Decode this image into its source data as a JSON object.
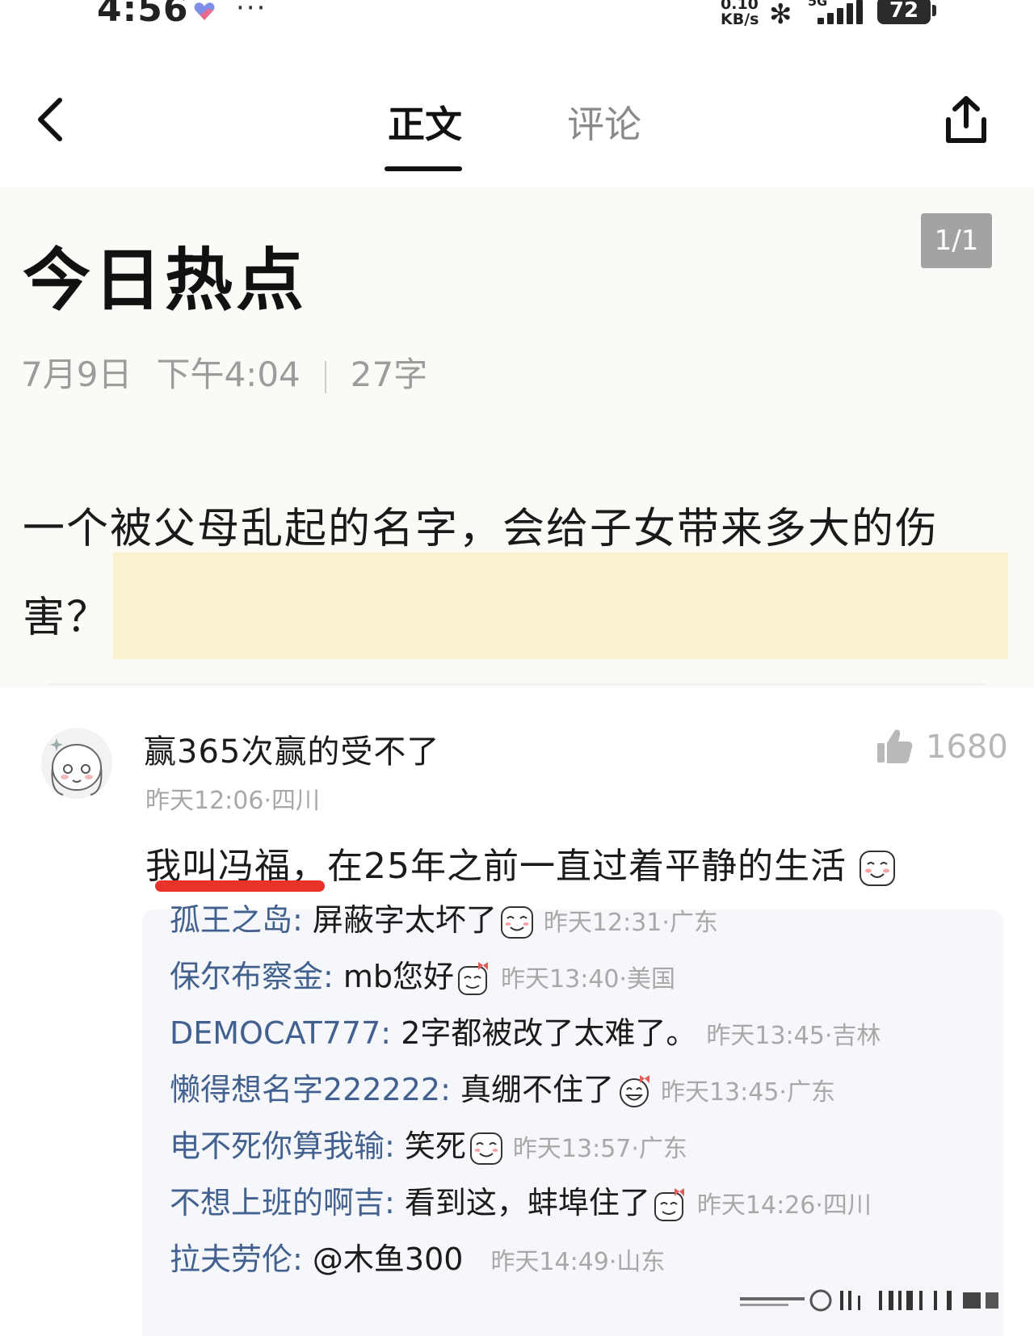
{
  "status_bar": {
    "time": "4:56",
    "more": "···",
    "net_speed_top": "0.10",
    "net_speed_unit": "KB/s",
    "network": "5G",
    "battery": "72"
  },
  "header": {
    "tabs": [
      {
        "label": "正文",
        "active": true
      },
      {
        "label": "评论",
        "active": false
      }
    ]
  },
  "article": {
    "title": "今日热点",
    "page_counter": "1/1",
    "date": "7月9日",
    "time": "下午4:04",
    "word_count": "27字",
    "headline": "一个被父母乱起的名字，会给子女带来多大的伤害？"
  },
  "comment": {
    "author": "赢365次赢的受不了",
    "likes": "1680",
    "meta": "昨天12:06·四川",
    "body": "我叫冯福，在25年之前一直过着平静的生活",
    "replies": [
      {
        "name": "孤王之岛",
        "text": "屏蔽字太坏了",
        "emoji": "smile-emoji",
        "meta": "昨天12:31·广东"
      },
      {
        "name": "保尔布察金",
        "text": "mb您好",
        "emoji": "bow-emoji",
        "meta": "昨天13:40·美国"
      },
      {
        "name": "DEMOCAT777",
        "text": "2字都被改了太难了。",
        "emoji": "",
        "meta": "昨天13:45·吉林"
      },
      {
        "name": "懒得想名字222222",
        "text": "真绷不住了",
        "emoji": "laugh-emoji",
        "meta": "昨天13:45·广东"
      },
      {
        "name": "电不死你算我输",
        "text": "笑死",
        "emoji": "smile-emoji",
        "meta": "昨天13:57·广东"
      },
      {
        "name": "不想上班的啊吉",
        "text": "看到这，蚌埠住了",
        "emoji": "bow-emoji",
        "meta": "昨天14:26·四川"
      },
      {
        "name": "拉夫劳伦",
        "text": "@木鱼300",
        "emoji": "",
        "meta": "昨天14:49·山东"
      }
    ]
  },
  "colors": {
    "highlight": "#faf1cf",
    "reply_name": "#42618f",
    "underline_red": "#e9332a"
  }
}
